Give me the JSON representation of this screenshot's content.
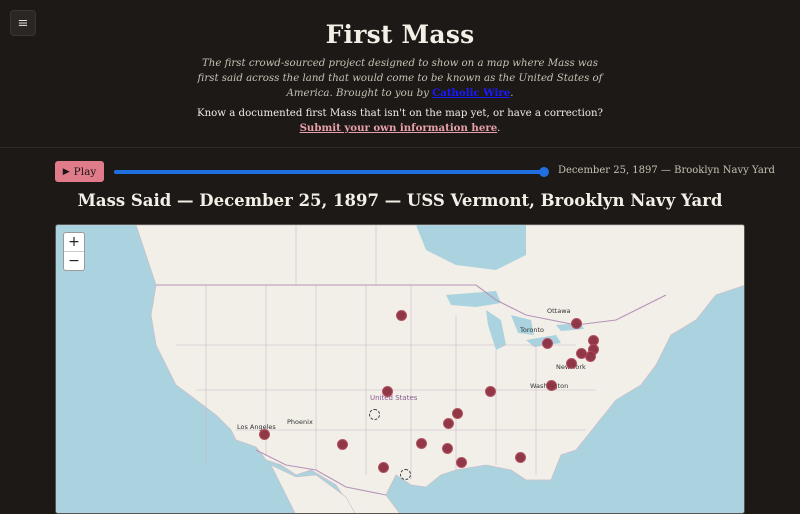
{
  "menu": {
    "icon": "hamburger-menu-icon",
    "glyph": "≡"
  },
  "header": {
    "title": "First Mass",
    "description": "The first crowd-sourced project designed to show on a map where Mass was first said across the land that would come to be known as the United States of America. Brought to you by ",
    "description_link": "Catholic Wire",
    "description_end": ".",
    "submit_text": "Know a documented first Mass that isn't on the map yet, or have a correction? ",
    "submit_link": "Submit your own information here",
    "submit_end": "."
  },
  "controls": {
    "play_icon": "play-icon",
    "play_glyph": "▶",
    "play_label": "Play",
    "slider_progress": 1.0,
    "slider_label": "December 25, 1897 — Brooklyn Navy Yard",
    "accent_color": "#1f6fe0",
    "play_color": "#e07c8a"
  },
  "main": {
    "heading": "Mass Said — December 25, 1897 — USS Vermont, Brooklyn Navy Yard"
  },
  "map": {
    "zoom_in": "+",
    "zoom_out": "−",
    "country_label": "United States",
    "cities": [
      "Ottawa",
      "Toronto",
      "New York",
      "Washington",
      "Los Angeles",
      "Phoenix"
    ],
    "marker_color": "#8b2f3f",
    "marker_count": 20
  }
}
